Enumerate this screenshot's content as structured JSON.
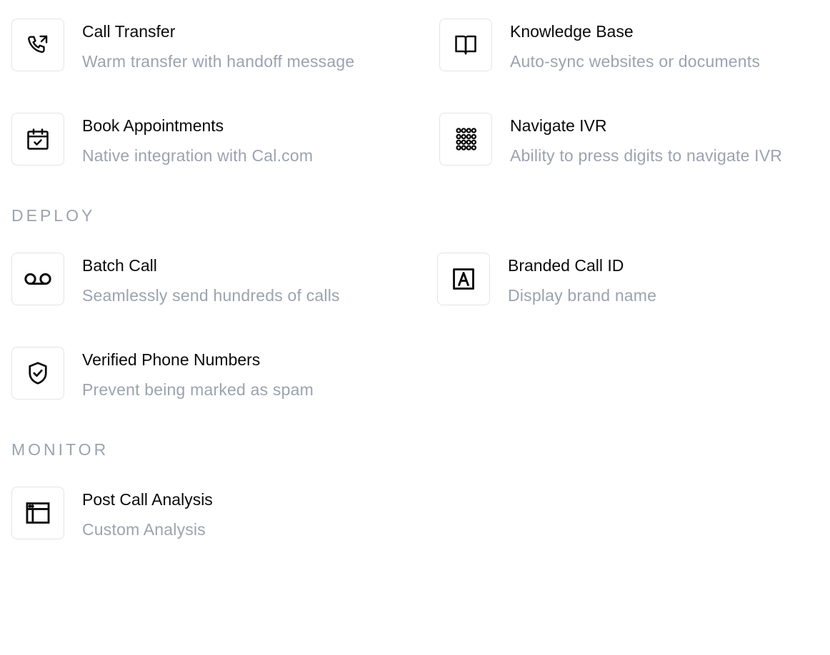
{
  "sections": {
    "deploy": "DEPLOY",
    "monitor": "MONITOR"
  },
  "features": {
    "call_transfer": {
      "icon": "phone-transfer-icon",
      "title": "Call Transfer",
      "desc": "Warm transfer with handoff message"
    },
    "knowledge_base": {
      "icon": "book-open-icon",
      "title": "Knowledge Base",
      "desc": "Auto-sync websites or documents"
    },
    "book_appointments": {
      "icon": "calendar-check-icon",
      "title": "Book Appointments",
      "desc": "Native integration with Cal.com"
    },
    "navigate_ivr": {
      "icon": "dialpad-icon",
      "title": "Navigate IVR",
      "desc": "Ability to press digits to navigate IVR"
    },
    "batch_call": {
      "icon": "voicemail-icon",
      "title": "Batch Call",
      "desc": "Seamlessly send hundreds of calls"
    },
    "branded_call_id": {
      "icon": "letter-a-box-icon",
      "title": "Branded Call ID",
      "desc": "Display brand name"
    },
    "verified_numbers": {
      "icon": "shield-check-icon",
      "title": "Verified Phone Numbers",
      "desc": "Prevent being marked as spam"
    },
    "post_call_analysis": {
      "icon": "browser-window-icon",
      "title": "Post Call Analysis",
      "desc": "Custom Analysis"
    }
  }
}
